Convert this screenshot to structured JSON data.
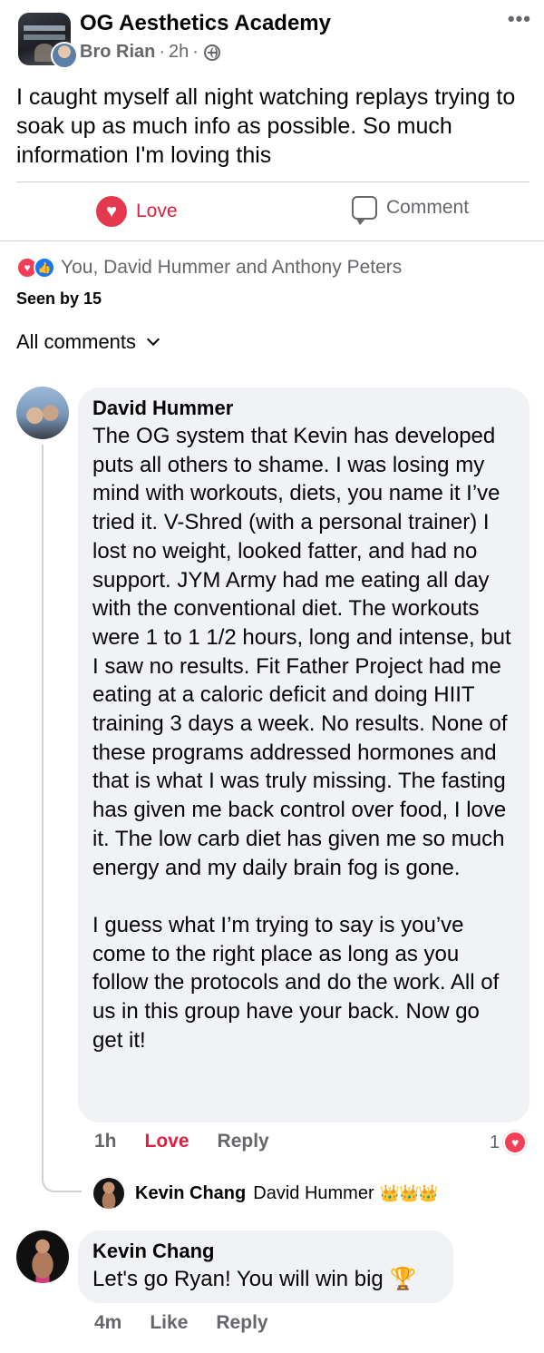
{
  "post": {
    "group_name": "OG Aesthetics Academy",
    "author": "Bro Rian",
    "time": "2h",
    "text": "I caught myself all night watching replays trying to soak up as much info as possible.  So much information I'm loving this"
  },
  "actions": {
    "love_label": "Love",
    "comment_label": "Comment"
  },
  "reactions": {
    "names": "You, David Hummer and Anthony Peters",
    "seen": "Seen by 15"
  },
  "filter": {
    "label": "All comments"
  },
  "comments": [
    {
      "name": "David Hummer",
      "text": "The OG system that Kevin has developed puts all others to shame. I was losing my mind with workouts, diets, you name it I’ve tried it. V-Shred (with a personal trainer) I lost no weight, looked fatter, and had no support. JYM Army had me eating all day with the conventional diet. The workouts were 1 to 1 1/2 hours, long and intense, but I saw no results. Fit Father Project had me eating at a caloric deficit and doing HIIT training 3 days a week. No results. None of these programs addressed hormones and that is what I was truly missing. The fasting has given me back control over food, I love it. The low carb diet has given me so much energy and my daily brain fog is gone.\n\nI guess what I’m trying to say is you’ve come to the right place as long as you follow the protocols and do the work. All of us in this group have your back. Now go get it!",
      "time": "1h",
      "reaction_label": "Love",
      "reply_label": "Reply",
      "reaction_count": "1",
      "reply_preview": {
        "name": "Kevin Chang",
        "snippet": "David Hummer",
        "emoji": "👑👑👑"
      }
    },
    {
      "name": "Kevin Chang",
      "text": "Let's go Ryan! You will win big",
      "emoji": "🏆",
      "time": "4m",
      "like_label": "Like",
      "reply_label": "Reply"
    }
  ],
  "colors": {
    "love": "#e41e3f",
    "like": "#1877f2",
    "secondary_text": "#65676b",
    "bubble": "#f0f2f5"
  }
}
